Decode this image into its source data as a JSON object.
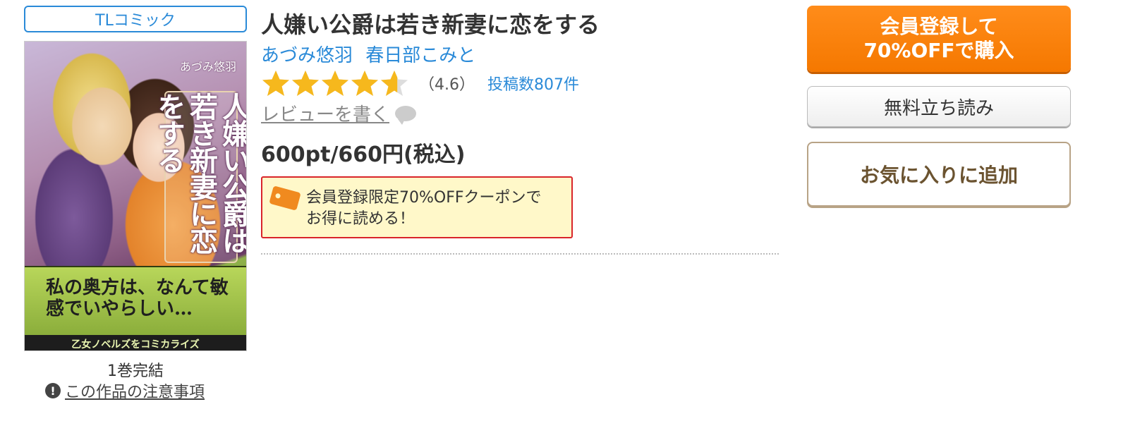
{
  "genre": "TLコミック",
  "cover": {
    "author_text": "あづみ悠羽",
    "title_text": "人嫌い公爵は若き新妻に恋をする",
    "band_text": "私の奥方は、なんて敏感でいやらしい…",
    "band_sub": "乙女ノベルズをコミカライズ"
  },
  "book": {
    "title": "人嫌い公爵は若き新妻に恋をする",
    "authors": [
      "あづみ悠羽",
      "春日部こみと"
    ],
    "rating_value": "（4.6）",
    "rating_score": 4.6,
    "review_count": "投稿数807件",
    "write_review": "レビューを書く",
    "price": "600pt/660円(税込)",
    "volume_status": "1巻完結",
    "caution_link": "この作品の注意事項"
  },
  "coupon": {
    "line1": "会員登録限定70%OFFクーポンで",
    "line2": "お得に読める！"
  },
  "actions": {
    "buy_line1": "会員登録して",
    "buy_line2": "70%OFFで購入",
    "preview": "無料立ち読み",
    "favorite": "お気に入りに追加"
  },
  "colors": {
    "accent_blue": "#2a8ad8",
    "buy_orange": "#f57800",
    "star_gold": "#f6b81d",
    "coupon_border": "#d9252a"
  }
}
